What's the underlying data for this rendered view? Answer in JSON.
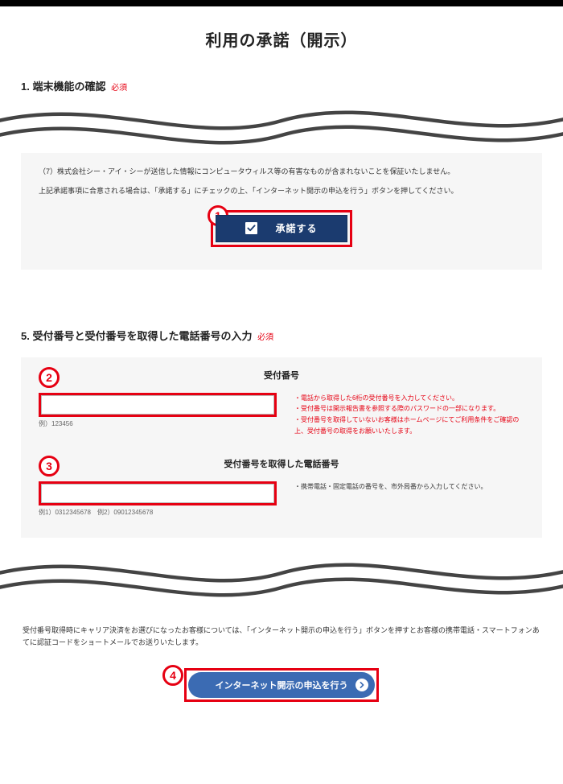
{
  "title": "利用の承諾（開示）",
  "section1": {
    "heading": "1. 端末機能の確認",
    "required": "必須"
  },
  "notice": {
    "line7": "（7）株式会社シー・アイ・シーが送信した情報にコンピュータウィルス等の有害なものが含まれないことを保証いたしません。",
    "agree": "上記承諾事項に合意される場合は、「承諾する」にチェックの上、「インターネット開示の申込を行う」ボタンを押してください。"
  },
  "steps": {
    "s1": "1",
    "s2": "2",
    "s3": "3",
    "s4": "4"
  },
  "consent_label": "承諾する",
  "section5": {
    "heading": "5. 受付番号と受付番号を取得した電話番号の入力",
    "required": "必須",
    "field1": {
      "title": "受付番号",
      "value": "",
      "example": "例）123456",
      "hints": [
        "・電話から取得した6桁の受付番号を入力してください。",
        "・受付番号は開示報告書を参照する際のパスワードの一部になります。",
        "・受付番号を取得していないお客様はホームページにてご利用条件をご確認の上、受付番号の取得をお願いいたします。"
      ]
    },
    "field2": {
      "title": "受付番号を取得した電話番号",
      "value": "",
      "example": "例1）0312345678　例2）09012345678",
      "hint": "・携帯電話・固定電話の番号を、市外局番から入力してください。"
    }
  },
  "bottom_note": "受付番号取得時にキャリア決済をお選びになったお客様については、「インターネット開示の申込を行う」ボタンを押すとお客様の携帯電話・スマートフォンあてに認証コードをショートメールでお送りいたします。",
  "submit_label": "インターネット開示の申込を行う"
}
